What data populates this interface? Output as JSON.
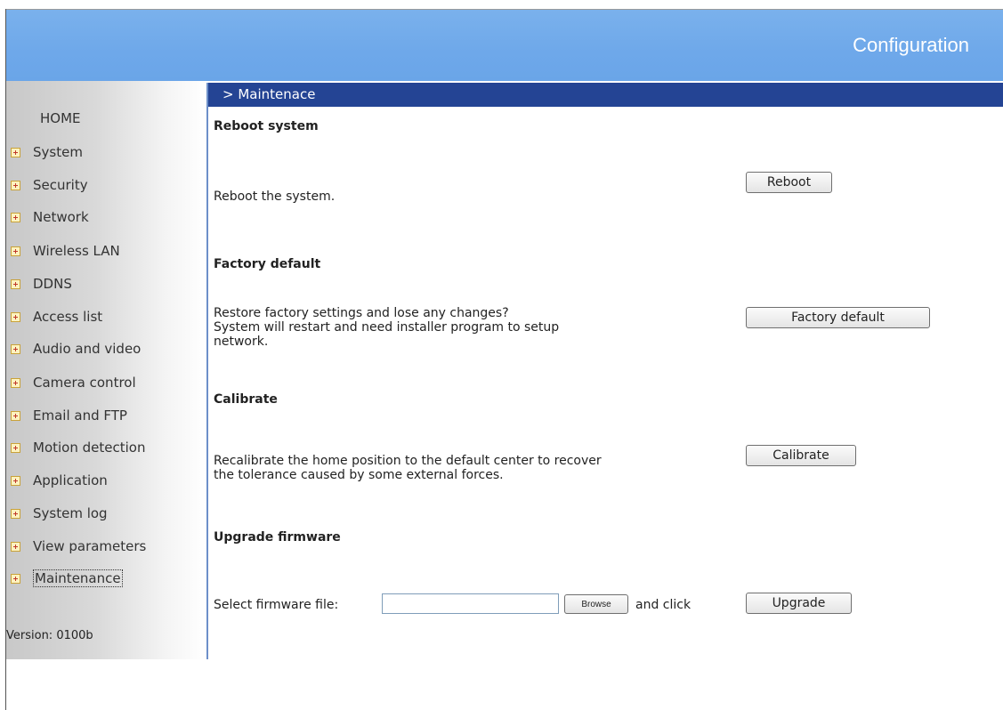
{
  "header": {
    "title": "Configuration"
  },
  "sidebar": {
    "home": "HOME",
    "items": [
      {
        "label": "System"
      },
      {
        "label": "Security"
      },
      {
        "label": "Network"
      },
      {
        "label": "Wireless LAN"
      },
      {
        "label": "DDNS"
      },
      {
        "label": "Access list"
      },
      {
        "label": "Audio and video"
      },
      {
        "label": "Camera control"
      },
      {
        "label": "Email and FTP"
      },
      {
        "label": "Motion detection"
      },
      {
        "label": "Application"
      },
      {
        "label": "System log"
      },
      {
        "label": "View parameters"
      },
      {
        "label": "Maintenance"
      }
    ],
    "version": "Version: 0100b"
  },
  "breadcrumb": "> Maintenace",
  "sections": {
    "reboot": {
      "title": "Reboot system",
      "description": "Reboot the system.",
      "button": "Reboot"
    },
    "factory": {
      "title": "Factory default",
      "description_line1": "Restore factory settings and lose any changes?",
      "description_line2": "System will restart and need installer program to setup",
      "description_line3": "network.",
      "button": "Factory default"
    },
    "calibrate": {
      "title": "Calibrate",
      "description_line1": "Recalibrate the home position to the default center to recover",
      "description_line2": "the tolerance caused by some external forces.",
      "button": "Calibrate"
    },
    "upgrade": {
      "title": "Upgrade firmware",
      "file_label": "Select firmware file:",
      "file_value": "",
      "browse_button": "Browse",
      "and_click": "and click",
      "button": "Upgrade"
    }
  },
  "colors": {
    "header_bg": "#6ea8ea",
    "breadcrumb_bg": "#244494",
    "divider": "#6d8fc9"
  }
}
